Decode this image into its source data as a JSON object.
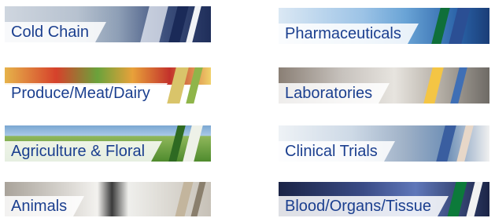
{
  "tiles": [
    {
      "id": "cold-chain",
      "label": "Cold Chain"
    },
    {
      "id": "pharmaceuticals",
      "label": "Pharmaceuticals"
    },
    {
      "id": "produce-meat-dairy",
      "label": "Produce/Meat/Dairy"
    },
    {
      "id": "laboratories",
      "label": "Laboratories"
    },
    {
      "id": "agriculture-floral",
      "label": "Agriculture & Floral"
    },
    {
      "id": "clinical-trials",
      "label": "Clinical Trials"
    },
    {
      "id": "animals",
      "label": "Animals"
    },
    {
      "id": "blood-organs-tissue",
      "label": "Blood/Organs/Tissue"
    }
  ],
  "colors": {
    "label_text": "#1b3f8f",
    "label_background": "#ffffff"
  }
}
